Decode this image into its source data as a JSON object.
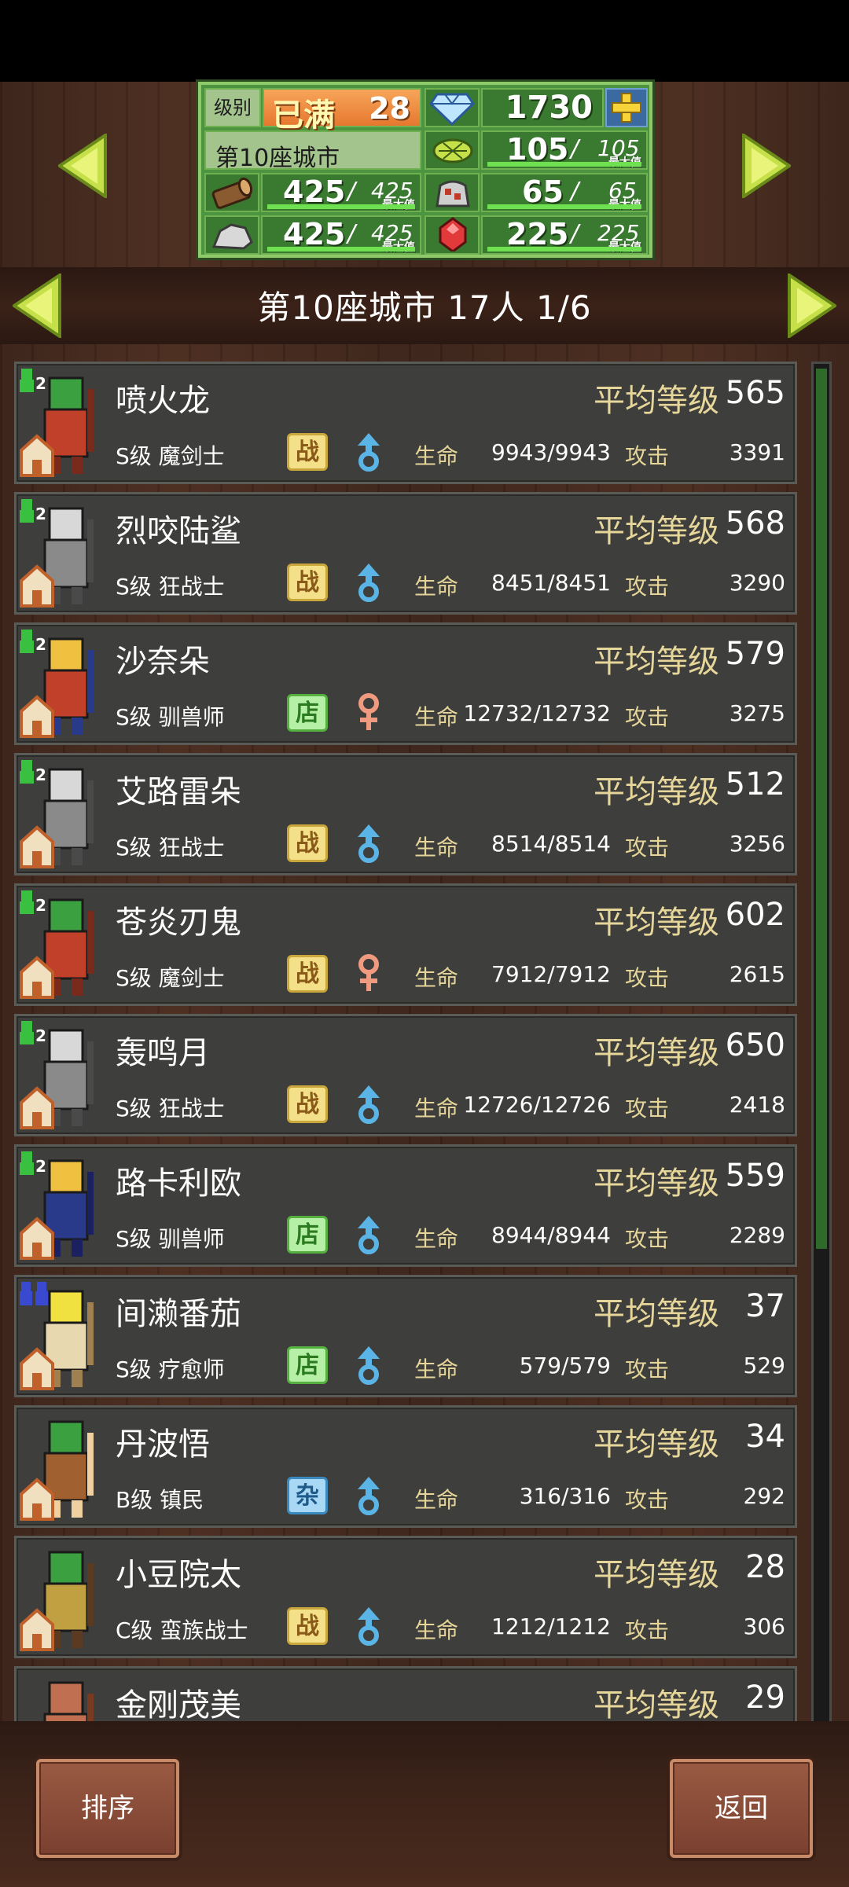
{
  "resources": {
    "level_label": "级别",
    "level_status": "已满",
    "level_value": "28",
    "gems": "1730",
    "city_name": "第10座城市",
    "food": "105",
    "food_max": "105",
    "wood": "425",
    "wood_max": "425",
    "ore": "65",
    "ore_max": "65",
    "stone": "425",
    "stone_max": "425",
    "crystal": "225",
    "crystal_max": "225",
    "max_label": "最大值",
    "slash": "/"
  },
  "header": {
    "title": "第10座城市  17人 1/6"
  },
  "labels": {
    "avg_level": "平均等级",
    "hp": "生命",
    "atk": "攻击"
  },
  "residents": [
    {
      "name": "喷火龙",
      "class": "S级 魔剑士",
      "job": "战",
      "gender": "male",
      "level": "565",
      "hp": "9943/9943",
      "atk": "3391",
      "avatar": "red-swordsman"
    },
    {
      "name": "烈咬陆鲨",
      "class": "S级 狂战士",
      "job": "战",
      "gender": "male",
      "level": "568",
      "hp": "8451/8451",
      "atk": "3290",
      "avatar": "grey-berserker"
    },
    {
      "name": "沙奈朵",
      "class": "S级 驯兽师",
      "job": "店",
      "gender": "female",
      "level": "579",
      "hp": "12732/12732",
      "atk": "3275",
      "avatar": "tamer"
    },
    {
      "name": "艾路雷朵",
      "class": "S级 狂战士",
      "job": "战",
      "gender": "male",
      "level": "512",
      "hp": "8514/8514",
      "atk": "3256",
      "avatar": "grey-berserker"
    },
    {
      "name": "苍炎刃鬼",
      "class": "S级 魔剑士",
      "job": "战",
      "gender": "female",
      "level": "602",
      "hp": "7912/7912",
      "atk": "2615",
      "avatar": "red-swordsman"
    },
    {
      "name": "轰鸣月",
      "class": "S级 狂战士",
      "job": "战",
      "gender": "male",
      "level": "650",
      "hp": "12726/12726",
      "atk": "2418",
      "avatar": "grey-berserker"
    },
    {
      "name": "路卡利欧",
      "class": "S级 驯兽师",
      "job": "店",
      "gender": "male",
      "level": "559",
      "hp": "8944/8944",
      "atk": "2289",
      "avatar": "blue-tamer"
    },
    {
      "name": "间濑番茄",
      "class": "S级 疗愈师",
      "job": "店",
      "gender": "male",
      "level": "37",
      "hp": "579/579",
      "atk": "529",
      "avatar": "healer"
    },
    {
      "name": "丹波悟",
      "class": "B级 镇民",
      "job": "杂",
      "gender": "male",
      "level": "34",
      "hp": "316/316",
      "atk": "292",
      "avatar": "townsman"
    },
    {
      "name": "小豆院太",
      "class": "C级 蛮族战士",
      "job": "战",
      "gender": "male",
      "level": "28",
      "hp": "1212/1212",
      "atk": "306",
      "avatar": "barbarian"
    },
    {
      "name": "金刚茂美",
      "class": "",
      "job": "",
      "gender": "",
      "level": "29",
      "hp": "",
      "atk": "",
      "avatar": "partial"
    }
  ],
  "buttons": {
    "sort": "排序",
    "back": "返回"
  },
  "colors": {
    "panel_green": "#4c9440",
    "row_bg": "#3e3e3c",
    "accent_gold": "#e6d69a",
    "male_blue": "#5ab4e6",
    "female_pink": "#f09a80",
    "arrow_green": "#c6e04a"
  }
}
